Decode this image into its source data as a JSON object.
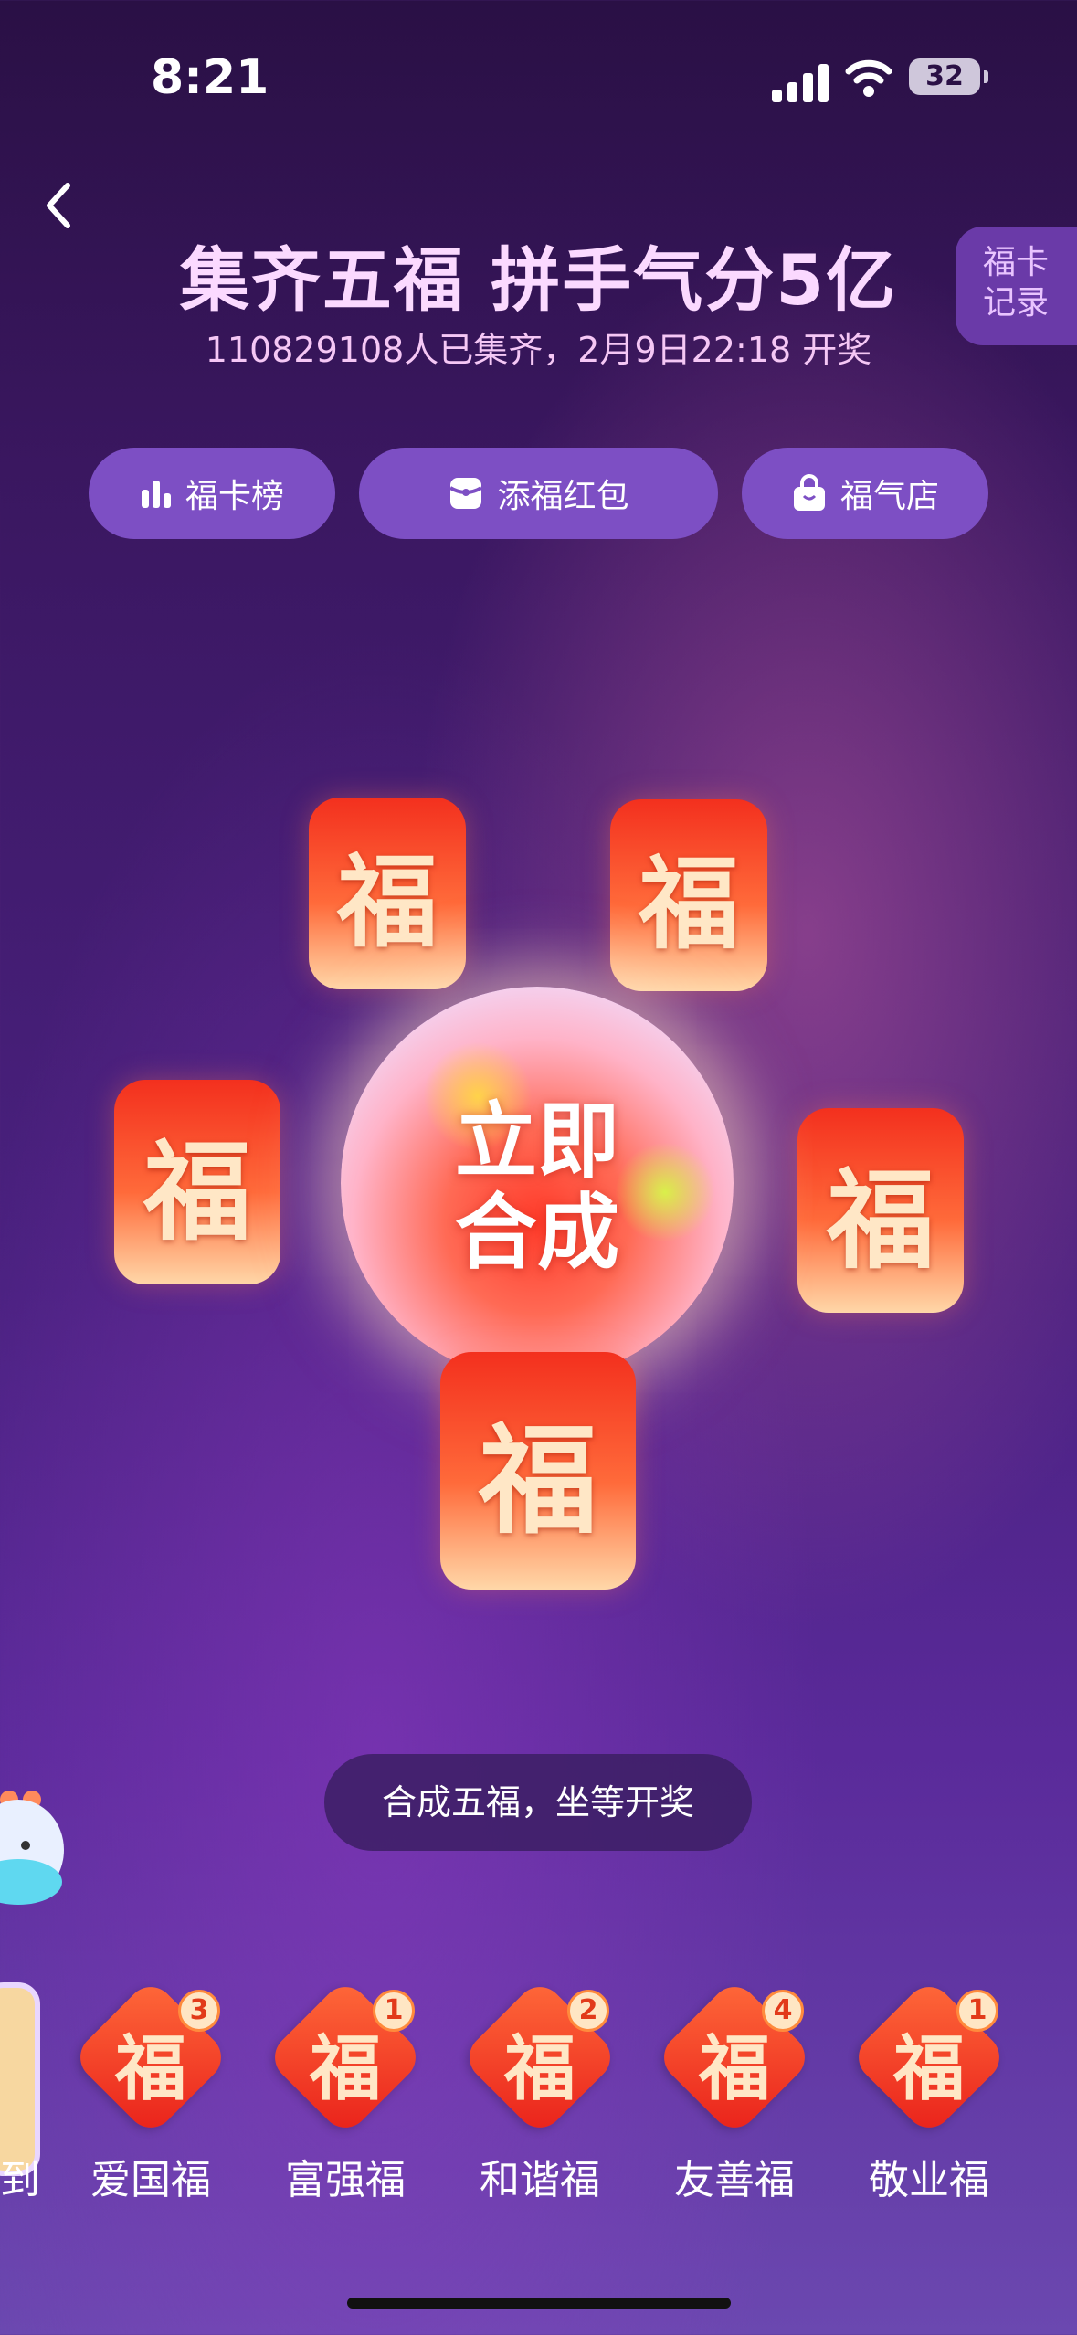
{
  "status_bar": {
    "time": "8:21",
    "battery": "32"
  },
  "header": {
    "title": "集齐五福 拼手气分5亿",
    "subtitle": "110829108人已集齐，2月9日22:18 开奖",
    "record_line1": "福卡",
    "record_line2": "记录"
  },
  "actions": [
    {
      "label": "福卡榜",
      "icon": "bar-chart-icon"
    },
    {
      "label": "添福红包",
      "icon": "red-envelope-icon"
    },
    {
      "label": "福气店",
      "icon": "shopping-bag-icon"
    }
  ],
  "center": {
    "line1": "立即",
    "line2": "合成"
  },
  "card_char": "福",
  "card_char_alt": "福",
  "hint": "合成五福，坐等开奖",
  "collection": {
    "partial_label": "到",
    "items": [
      {
        "name": "爱国福",
        "count": "3"
      },
      {
        "name": "富强福",
        "count": "1"
      },
      {
        "name": "和谐福",
        "count": "2"
      },
      {
        "name": "友善福",
        "count": "4"
      },
      {
        "name": "敬业福",
        "count": "1"
      }
    ]
  }
}
